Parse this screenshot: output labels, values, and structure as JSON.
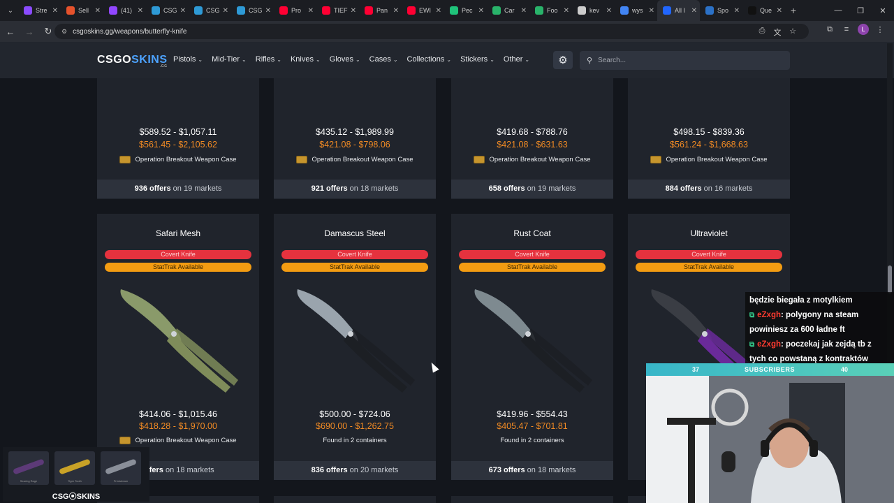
{
  "browser": {
    "tabs": [
      {
        "label": "Stre",
        "color": "#8a4bff"
      },
      {
        "label": "Sell",
        "color": "#e6522c"
      },
      {
        "label": "(41)",
        "color": "#9146ff"
      },
      {
        "label": "CSG",
        "color": "#2e9ad6"
      },
      {
        "label": "CSG",
        "color": "#2e9ad6"
      },
      {
        "label": "CSG",
        "color": "#2e9ad6"
      },
      {
        "label": "Pro",
        "color": "#ff0033"
      },
      {
        "label": "TIEF",
        "color": "#ff0033"
      },
      {
        "label": "Pan",
        "color": "#ff0033"
      },
      {
        "label": "EWI",
        "color": "#ff0033"
      },
      {
        "label": "Pec",
        "color": "#1fc37a"
      },
      {
        "label": "Car",
        "color": "#29b36a"
      },
      {
        "label": "Foo",
        "color": "#29b36a"
      },
      {
        "label": "kev",
        "color": "#cccccc"
      },
      {
        "label": "wys",
        "color": "#4285f4"
      },
      {
        "label": "All I",
        "color": "#2166ff"
      },
      {
        "label": "Spo",
        "color": "#2b71c7"
      },
      {
        "label": "Que",
        "color": "#111111"
      }
    ],
    "active_tab_index": 15,
    "url": "csgoskins.gg/weapons/butterfly-knife"
  },
  "site": {
    "logo_main": "CSGO",
    "logo_accent": "SKINS",
    "logo_sub": ".GG",
    "menu": [
      "Pistols",
      "Mid-Tier",
      "Rifles",
      "Knives",
      "Gloves",
      "Cases",
      "Collections",
      "Stickers",
      "Other"
    ],
    "search_placeholder": "Search..."
  },
  "top_cards": [
    {
      "price_range": "$589.52 - $1,057.11",
      "stattrak_range": "$561.45 - $2,105.62",
      "container": "Operation Breakout Weapon Case",
      "offers": "936 offers",
      "markets": "on 19 markets"
    },
    {
      "price_range": "$435.12 - $1,989.99",
      "stattrak_range": "$421.08 - $798.06",
      "container": "Operation Breakout Weapon Case",
      "offers": "921 offers",
      "markets": "on 18 markets"
    },
    {
      "price_range": "$419.68 - $788.76",
      "stattrak_range": "$421.08 - $631.63",
      "container": "Operation Breakout Weapon Case",
      "offers": "658 offers",
      "markets": "on 19 markets"
    },
    {
      "price_range": "$498.15 - $839.36",
      "stattrak_range": "$561.24 - $1,668.63",
      "container": "Operation Breakout Weapon Case",
      "offers": "884 offers",
      "markets": "on 16 markets"
    }
  ],
  "cards": [
    {
      "name": "Safari Mesh",
      "rarity": "Covert Knife",
      "stattrak": "StatTrak Available",
      "price_range": "$414.06 - $1,015.46",
      "stattrak_range": "$418.28 - $1,970.00",
      "container": "Operation Breakout Weapon Case",
      "has_case_icon": true,
      "offers": "offers",
      "markets": "on 18 markets",
      "blade": "#8a9a6a",
      "handle": "#7f8c5a"
    },
    {
      "name": "Damascus Steel",
      "rarity": "Covert Knife",
      "stattrak": "StatTrak Available",
      "price_range": "$500.00 - $724.06",
      "stattrak_range": "$690.00 - $1,262.75",
      "container": "Found in 2 containers",
      "has_case_icon": false,
      "offers": "836 offers",
      "markets": "on 20 markets",
      "blade": "#9aa4ad",
      "handle": "#1c1f24"
    },
    {
      "name": "Rust Coat",
      "rarity": "Covert Knife",
      "stattrak": "StatTrak Available",
      "price_range": "$419.96 - $554.43",
      "stattrak_range": "$405.47 - $701.81",
      "container": "Found in 2 containers",
      "has_case_icon": false,
      "offers": "673 offers",
      "markets": "on 18 markets",
      "blade": "#7e8a90",
      "handle": "#1c1f24"
    },
    {
      "name": "Ultraviolet",
      "rarity": "Covert Knife",
      "stattrak": "StatTrak Available",
      "price_range": "",
      "stattrak_range": "",
      "container": "",
      "has_case_icon": false,
      "offers": "",
      "markets": "",
      "blade": "#3a3d44",
      "handle": "#6a2a9a"
    }
  ],
  "chat": [
    {
      "user": "",
      "text": "będzie biegała z motylkiem"
    },
    {
      "user": "eZxgh",
      "text": ": polygony na steam"
    },
    {
      "user": "",
      "text": "powiniesz za 600 ładne ft"
    },
    {
      "user": "eZxgh",
      "text": ": poczekaj jak zejdą tb z"
    },
    {
      "user": "",
      "text": "tych co powstaną z kontraktów"
    }
  ],
  "webcam": {
    "sub_left": "37",
    "sub_label": "SUBSCRIBERS",
    "sub_right": "40"
  },
  "promo": {
    "label": "CSG⦿SKINS",
    "tiles": [
      "Searing Rage",
      "Tiger Tooth",
      "Printstream"
    ]
  }
}
